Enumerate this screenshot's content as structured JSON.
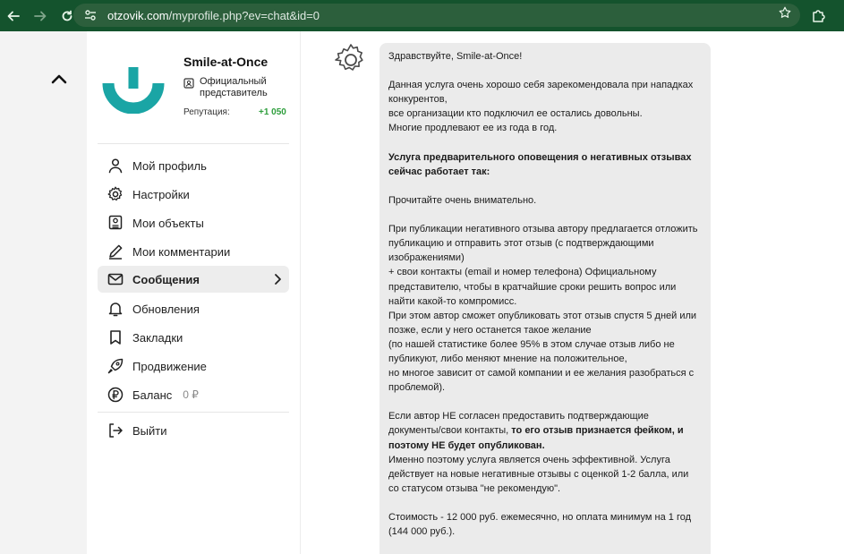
{
  "browser": {
    "back_icon": "arrow-left-icon",
    "forward_icon": "arrow-right-icon",
    "reload_icon": "reload-icon",
    "url_host": "otzovik.com",
    "url_path": "/myprofile.php?ev=chat&id=0",
    "star_icon": "star-icon",
    "extensions_icon": "puzzle-icon",
    "bar_color": "#14532d"
  },
  "profile": {
    "name": "Smile-at-Once",
    "badge": "Официальный представитель",
    "reputation_label": "Репутация:",
    "reputation_value": "+1 050",
    "logo_color": "#1aa5a5"
  },
  "sidebar": {
    "items": [
      {
        "label": "Мой профиль",
        "icon": "user-icon"
      },
      {
        "label": "Настройки",
        "icon": "gear-icon"
      },
      {
        "label": "Мои объекты",
        "icon": "objects-icon"
      },
      {
        "label": "Мои комментарии",
        "icon": "pen-icon"
      },
      {
        "label": "Сообщения",
        "icon": "envelope-icon",
        "active": true
      },
      {
        "label": "Обновления",
        "icon": "bell-icon"
      },
      {
        "label": "Закладки",
        "icon": "bookmark-icon"
      },
      {
        "label": "Продвижение",
        "icon": "rocket-icon"
      },
      {
        "label": "Баланс",
        "icon": "ruble-icon",
        "extra": "0 ₽"
      },
      {
        "label": "Выйти",
        "icon": "logout-icon"
      }
    ]
  },
  "message": {
    "greeting": "Здравствуйте, Smile-at-Once!",
    "p1": "Данная услуга очень хорошо себя зарекомендовала при нападках конкурентов,",
    "p1b": "все организации кто подключил ее остались довольны.",
    "p1c": "Многие продлевают ее из года в год.",
    "p2_bold": "Услуга предварительного оповещения о негативных отзывах сейчас работает так:",
    "p3": "Прочитайте очень внимательно.",
    "p4a": "При публикации негативного отзыва автору предлагается отложить публикацию и отправить этот отзыв (с подтверждающими изображениями)",
    "p4b": "+ свои контакты (email и номер телефона) Официальному представителю, чтобы в кратчайшие сроки решить вопрос или найти какой-то компромисс.",
    "p4c": "При этом автор сможет опубликовать этот отзыв спустя 5 дней или позже, если у него останется такое желание",
    "p4d": "(по нашей статистике более 95% в этом случае отзыв либо не публикуют, либо меняют мнение на положительное,",
    "p4e": "но многое зависит от самой компании и ее желания разобраться с проблемой).",
    "p5a": "Если автор НЕ согласен предоставить подтверждающие документы/свои контакты, ",
    "p5_bold": "то его отзыв признается фейком, и поэтому НЕ будет опубликован.",
    "p5b": "Именно поэтому услуга является очень эффективной. Услуга действует на новые негативные отзывы с оценкой 1-2 балла, или со статусом отзыва \"не рекомендую\".",
    "p6": "Стоимость - 12 000 руб. ежемесячно, но оплата минимум на 1 год (144 000 руб.)."
  }
}
